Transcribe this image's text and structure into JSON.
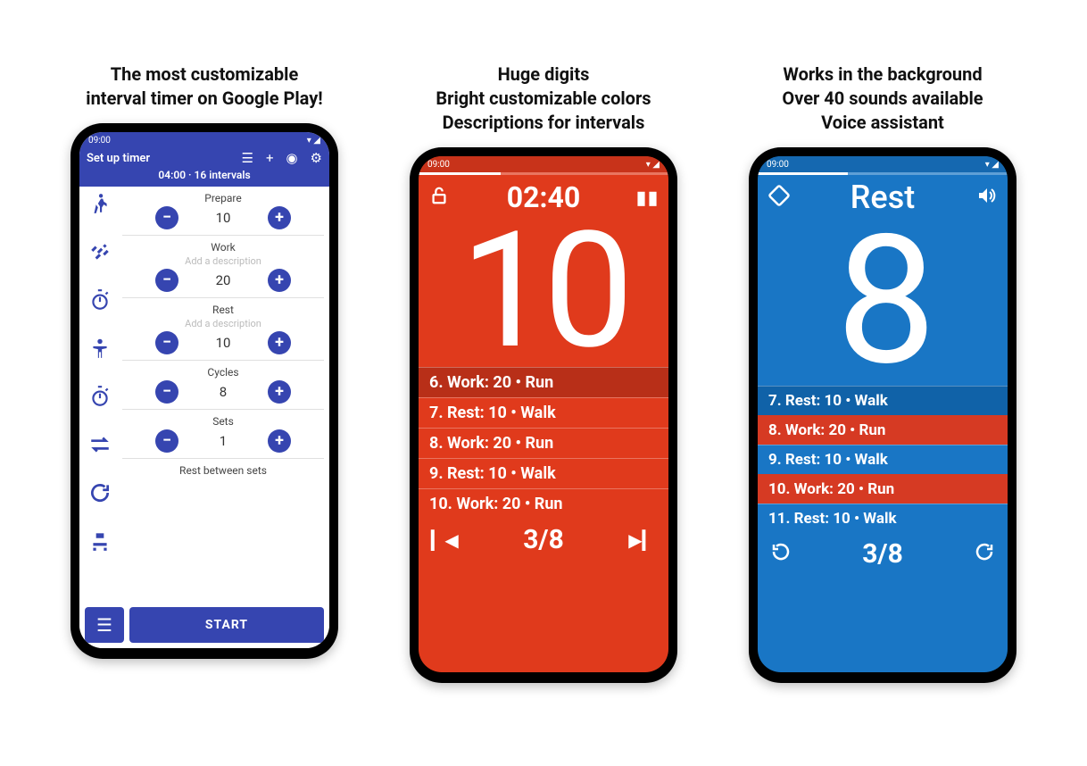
{
  "colors": {
    "blue": "#3645b0",
    "red": "#e03a1c",
    "cyan": "#1976c5"
  },
  "captions": {
    "s1a": "The most customizable",
    "s1b": "interval timer on Google Play!",
    "s2a": "Huge digits",
    "s2b": "Bright customizable colors",
    "s2c": "Descriptions for intervals",
    "s3a": "Works in the background",
    "s3b": "Over 40 sounds available",
    "s3c": "Voice assistant"
  },
  "status_time": "09:00",
  "screen1": {
    "title": "Set up timer",
    "summary": "04:00 · 16 intervals",
    "params": [
      {
        "label": "Prepare",
        "value": "10"
      },
      {
        "label": "Work",
        "desc": "Add a description",
        "value": "20"
      },
      {
        "label": "Rest",
        "desc": "Add a description",
        "value": "10"
      },
      {
        "label": "Cycles",
        "value": "8"
      },
      {
        "label": "Sets",
        "value": "1"
      },
      {
        "label": "Rest between sets",
        "value": ""
      }
    ],
    "start": "START"
  },
  "screen2": {
    "elapsed": "02:40",
    "big": "10",
    "intervals": [
      "6. Work: 20 • Run",
      "7. Rest: 10 • Walk",
      "8. Work: 20 • Run",
      "9. Rest: 10 • Walk",
      "10. Work: 20 • Run"
    ],
    "count": "3/8",
    "progress_pct": 33
  },
  "screen3": {
    "label": "Rest",
    "big": "8",
    "intervals": [
      {
        "text": "7. Rest: 10 • Walk",
        "type": "active"
      },
      {
        "text": "8. Work: 20 • Run",
        "type": "red"
      },
      {
        "text": "9. Rest: 10 • Walk",
        "type": "normal"
      },
      {
        "text": "10. Work: 20 • Run",
        "type": "red"
      },
      {
        "text": "11. Rest: 10 • Walk",
        "type": "normal"
      }
    ],
    "count": "3/8",
    "progress_pct": 36
  }
}
